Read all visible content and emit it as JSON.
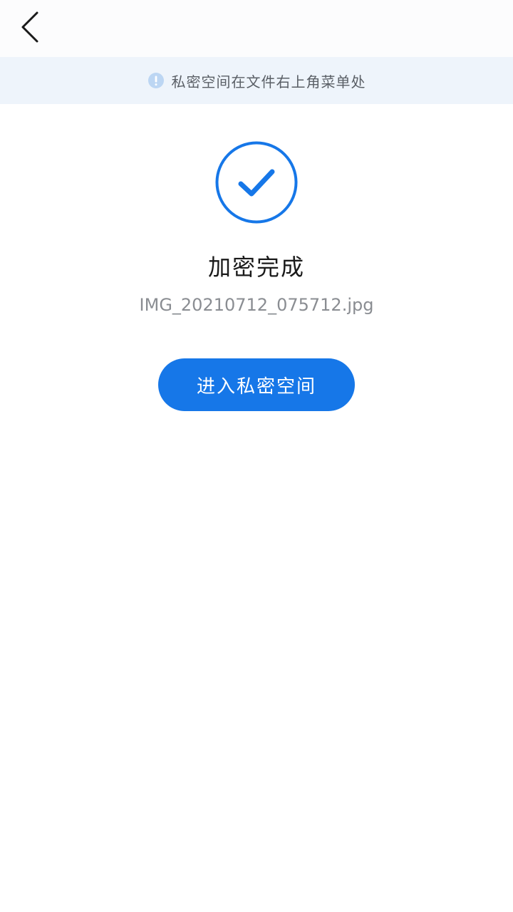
{
  "header": {
    "back_icon": "chevron-left-icon"
  },
  "notice": {
    "icon": "info-icon",
    "text": "私密空间在文件右上角菜单处"
  },
  "result": {
    "icon": "check-circle-icon",
    "title": "加密完成",
    "file_name": "IMG_20210712_075712.jpg"
  },
  "action": {
    "enter_label": "进入私密空间"
  },
  "colors": {
    "accent": "#1677e8",
    "notice_bg": "#eef4fb",
    "title_text": "#1a1a1a",
    "secondary_text": "#8a8d92"
  }
}
